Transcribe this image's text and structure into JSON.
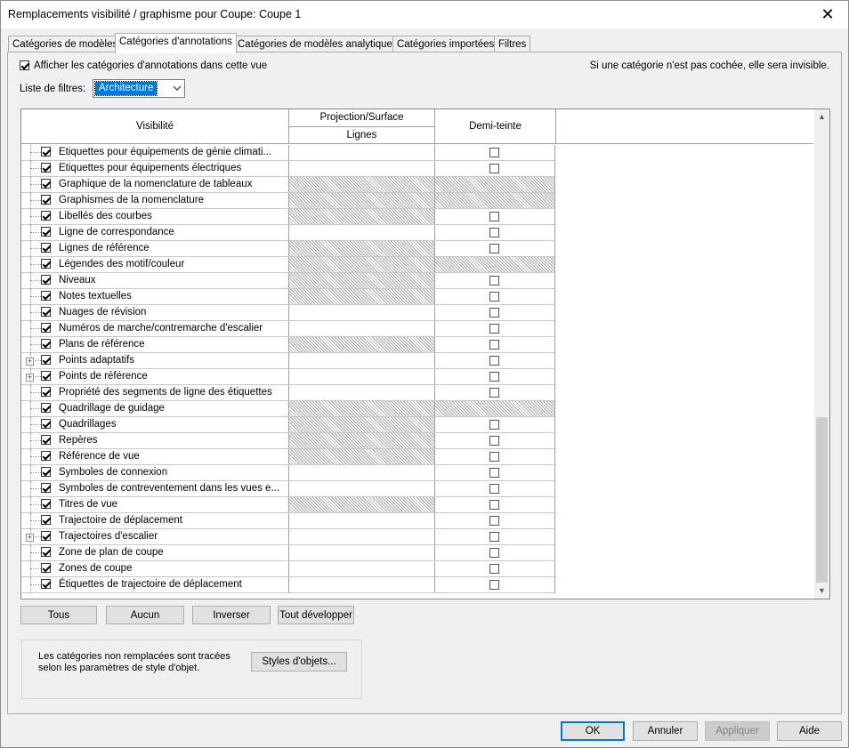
{
  "window": {
    "title": "Remplacements visibilité / graphisme pour Coupe: Coupe 1",
    "close_glyph": "✕"
  },
  "tabs": [
    {
      "label": "Catégories de modèles"
    },
    {
      "label": "Catégories d'annotations"
    },
    {
      "label": "Catégories de modèles analytiques"
    },
    {
      "label": "Catégories importées"
    },
    {
      "label": "Filtres"
    }
  ],
  "active_tab": 1,
  "show_categories": {
    "label": "Afficher les catégories d'annotations dans cette vue",
    "checked": true
  },
  "hint": "Si une catégorie n'est pas cochée, elle sera invisible.",
  "filter": {
    "label": "Liste de filtres:",
    "value": "Architecture"
  },
  "grid": {
    "col_visibility": "Visibilité",
    "col_projection": "Projection/Surface",
    "col_lines": "Lignes",
    "col_halftone": "Demi-teinte",
    "rows": [
      {
        "name": "Etiquettes pour équipements de génie climati...",
        "checked": true,
        "lines_hatched": false,
        "half_hatched": false,
        "expandable": false
      },
      {
        "name": "Etiquettes pour équipements électriques",
        "checked": true,
        "lines_hatched": false,
        "half_hatched": false,
        "expandable": false
      },
      {
        "name": "Graphique de la nomenclature de tableaux",
        "checked": true,
        "lines_hatched": true,
        "half_hatched": true,
        "expandable": false
      },
      {
        "name": "Graphismes de la nomenclature",
        "checked": true,
        "lines_hatched": true,
        "half_hatched": true,
        "expandable": false
      },
      {
        "name": "Libellés des courbes",
        "checked": true,
        "lines_hatched": true,
        "half_hatched": false,
        "expandable": false
      },
      {
        "name": "Ligne de correspondance",
        "checked": true,
        "lines_hatched": false,
        "half_hatched": false,
        "expandable": false
      },
      {
        "name": "Lignes de référence",
        "checked": true,
        "lines_hatched": true,
        "half_hatched": false,
        "expandable": false
      },
      {
        "name": "Légendes des motif/couleur",
        "checked": true,
        "lines_hatched": true,
        "half_hatched": true,
        "expandable": false
      },
      {
        "name": "Niveaux",
        "checked": true,
        "lines_hatched": true,
        "half_hatched": false,
        "expandable": false
      },
      {
        "name": "Notes textuelles",
        "checked": true,
        "lines_hatched": true,
        "half_hatched": false,
        "expandable": false
      },
      {
        "name": "Nuages de révision",
        "checked": true,
        "lines_hatched": false,
        "half_hatched": false,
        "expandable": false
      },
      {
        "name": "Numéros de marche/contremarche d'escalier",
        "checked": true,
        "lines_hatched": false,
        "half_hatched": false,
        "expandable": false
      },
      {
        "name": "Plans de référence",
        "checked": true,
        "lines_hatched": true,
        "half_hatched": false,
        "expandable": false
      },
      {
        "name": "Points adaptatifs",
        "checked": true,
        "lines_hatched": false,
        "half_hatched": false,
        "expandable": true
      },
      {
        "name": "Points de référence",
        "checked": true,
        "lines_hatched": false,
        "half_hatched": false,
        "expandable": true
      },
      {
        "name": "Propriété des segments de ligne des étiquettes",
        "checked": true,
        "lines_hatched": false,
        "half_hatched": false,
        "expandable": false
      },
      {
        "name": "Quadrillage de guidage",
        "checked": true,
        "lines_hatched": true,
        "half_hatched": true,
        "expandable": false
      },
      {
        "name": "Quadrillages",
        "checked": true,
        "lines_hatched": true,
        "half_hatched": false,
        "expandable": false
      },
      {
        "name": "Repères",
        "checked": true,
        "lines_hatched": true,
        "half_hatched": false,
        "expandable": false
      },
      {
        "name": "Référence de vue",
        "checked": true,
        "lines_hatched": true,
        "half_hatched": false,
        "expandable": false
      },
      {
        "name": "Symboles de connexion",
        "checked": true,
        "lines_hatched": false,
        "half_hatched": false,
        "expandable": false
      },
      {
        "name": "Symboles de contreventement dans les vues e...",
        "checked": true,
        "lines_hatched": false,
        "half_hatched": false,
        "expandable": false
      },
      {
        "name": "Titres de vue",
        "checked": true,
        "lines_hatched": true,
        "half_hatched": false,
        "expandable": false
      },
      {
        "name": "Trajectoire de déplacement",
        "checked": true,
        "lines_hatched": false,
        "half_hatched": false,
        "expandable": false
      },
      {
        "name": "Trajectoires d'escalier",
        "checked": true,
        "lines_hatched": false,
        "half_hatched": false,
        "expandable": true
      },
      {
        "name": "Zone de plan de coupe",
        "checked": true,
        "lines_hatched": false,
        "half_hatched": false,
        "expandable": false
      },
      {
        "name": "Zones de coupe",
        "checked": true,
        "lines_hatched": false,
        "half_hatched": false,
        "expandable": false
      },
      {
        "name": "Étiquettes de trajectoire de déplacement",
        "checked": true,
        "lines_hatched": false,
        "half_hatched": false,
        "expandable": false
      }
    ]
  },
  "actions": {
    "all": "Tous",
    "none": "Aucun",
    "invert": "Inverser",
    "expand_all": "Tout développer"
  },
  "info": {
    "line1": "Les catégories non remplacées sont tracées",
    "line2": "selon les paramètres de style d'objet.",
    "object_styles": "Styles d'objets..."
  },
  "footer": {
    "ok": "OK",
    "cancel": "Annuler",
    "apply": "Appliquer",
    "help": "Aide"
  },
  "icons": {
    "scroll_up": "up-arrow-icon",
    "scroll_down": "down-arrow-icon",
    "dropdown": "chevron-down-icon"
  }
}
